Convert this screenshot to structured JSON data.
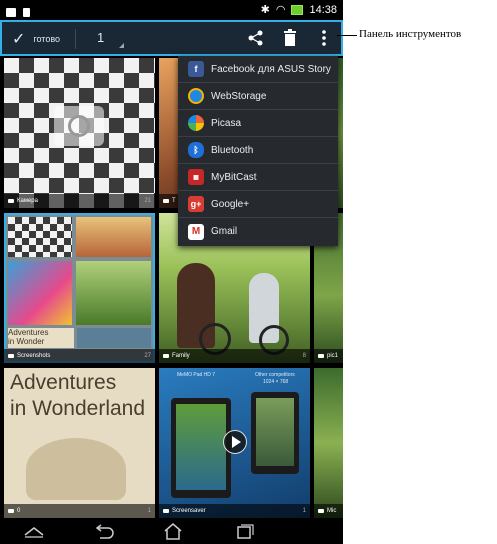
{
  "status_bar": {
    "time": "14:38"
  },
  "action_bar": {
    "done_label": "готово",
    "selected_count": "1"
  },
  "share_menu": {
    "items": [
      {
        "label": "Facebook для ASUS Story",
        "icon": "facebook-icon",
        "color": "#3b5998"
      },
      {
        "label": "WebStorage",
        "icon": "webstorage-icon",
        "color": "#1e88e5"
      },
      {
        "label": "Picasa",
        "icon": "picasa-icon",
        "color": "#e8663a"
      },
      {
        "label": "Bluetooth",
        "icon": "bluetooth-icon",
        "color": "#1f6fd6"
      },
      {
        "label": "MyBitCast",
        "icon": "mybitcast-icon",
        "color": "#c62828"
      },
      {
        "label": "Google+",
        "icon": "googleplus-icon",
        "color": "#d73d32"
      },
      {
        "label": "Gmail",
        "icon": "gmail-icon",
        "color": "#ffffff"
      }
    ]
  },
  "albums": [
    {
      "name": "Камера",
      "count": "21"
    },
    {
      "name": "T"
    },
    {
      "name": "Screenshots",
      "count": "27"
    },
    {
      "name": "Family",
      "count": "8"
    },
    {
      "name": "pic1"
    },
    {
      "name": "0",
      "count": "1"
    },
    {
      "name": "Screensaver",
      "count": "1"
    },
    {
      "name": "Mic"
    }
  ],
  "thumbnail_text": {
    "book_title_1": "Adventures",
    "book_title_2": "in Wonderland",
    "small_book_1": "Adventures",
    "small_book_2": "in Wonder",
    "memo_1": "MeMO Pad HD 7",
    "memo_2": "Other competitors",
    "memo_3": "1024 × 768"
  },
  "callout": {
    "label": "Панель инструментов"
  },
  "colors": {
    "accent": "#34b0e8",
    "action_bar": "#1a2735",
    "menu": "#262a2e"
  }
}
